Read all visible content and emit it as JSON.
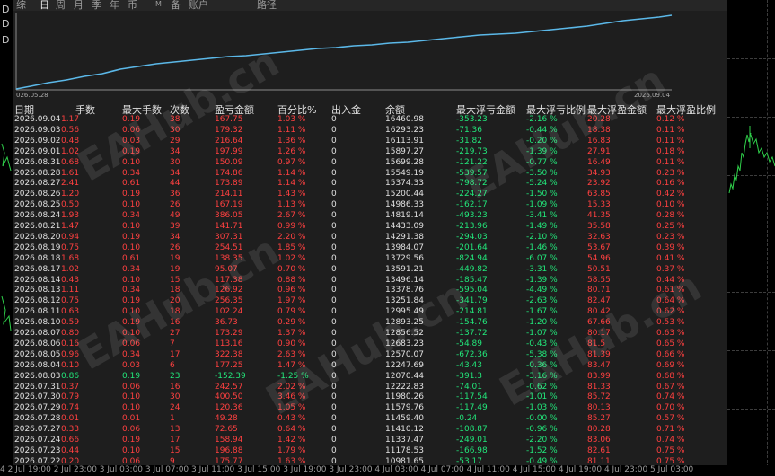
{
  "tabs": [
    "综",
    "日",
    "周",
    "月",
    "季",
    "年",
    "币",
    "M",
    "备",
    "账户",
    "路径"
  ],
  "active_tab": "日",
  "curve": {
    "start_label": "026.05.28",
    "end_label": "2026.09.04",
    "line_color": "#5bb8e8"
  },
  "headers": {
    "date": "日期",
    "lots": "手数",
    "max_lots": "最大手数",
    "count": "次数",
    "pnl": "盈亏金额",
    "pct": "百分比%",
    "io": "出入金",
    "balance": "余额",
    "max_float_loss": "最大浮亏金额",
    "max_float_loss_pct": "最大浮亏比例",
    "max_float_profit": "最大浮盈金额",
    "max_float_profit_pct": "最大浮盈比例"
  },
  "rows": [
    {
      "date": "2026.09.04",
      "lots": "1.17",
      "max_lots": "0.19",
      "count": "38",
      "pnl": "167.75",
      "pct": "1.03 %",
      "io": "0",
      "balance": "16460.98",
      "fl": "-353.23",
      "flp": "-2.16 %",
      "fp": "20.28",
      "fpp": "0.12 %"
    },
    {
      "date": "2026.09.03",
      "lots": "0.56",
      "max_lots": "0.06",
      "count": "30",
      "pnl": "179.32",
      "pct": "1.11 %",
      "io": "0",
      "balance": "16293.23",
      "fl": "-71.36",
      "flp": "-0.44 %",
      "fp": "18.38",
      "fpp": "0.11 %"
    },
    {
      "date": "2026.09.02",
      "lots": "0.48",
      "max_lots": "0.03",
      "count": "29",
      "pnl": "216.64",
      "pct": "1.36 %",
      "io": "0",
      "balance": "16113.91",
      "fl": "-31.82",
      "flp": "-0.20 %",
      "fp": "16.83",
      "fpp": "0.11 %"
    },
    {
      "date": "2026.09.01",
      "lots": "1.02",
      "max_lots": "0.19",
      "count": "34",
      "pnl": "197.99",
      "pct": "1.26 %",
      "io": "0",
      "balance": "15897.27",
      "fl": "-219.73",
      "flp": "-1.39 %",
      "fp": "27.91",
      "fpp": "0.18 %"
    },
    {
      "date": "2026.08.31",
      "lots": "0.68",
      "max_lots": "0.10",
      "count": "30",
      "pnl": "150.09",
      "pct": "0.97 %",
      "io": "0",
      "balance": "15699.28",
      "fl": "-121.22",
      "flp": "-0.77 %",
      "fp": "16.49",
      "fpp": "0.11 %"
    },
    {
      "date": "2026.08.28",
      "lots": "1.61",
      "max_lots": "0.34",
      "count": "34",
      "pnl": "174.86",
      "pct": "1.14 %",
      "io": "0",
      "balance": "15549.19",
      "fl": "-539.57",
      "flp": "-3.50 %",
      "fp": "34.93",
      "fpp": "0.23 %"
    },
    {
      "date": "2026.08.27",
      "lots": "2.41",
      "max_lots": "0.61",
      "count": "44",
      "pnl": "173.89",
      "pct": "1.14 %",
      "io": "0",
      "balance": "15374.33",
      "fl": "-798.72",
      "flp": "-5.24 %",
      "fp": "23.92",
      "fpp": "0.16 %"
    },
    {
      "date": "2026.08.26",
      "lots": "1.20",
      "max_lots": "0.19",
      "count": "36",
      "pnl": "214.11",
      "pct": "1.43 %",
      "io": "0",
      "balance": "15200.44",
      "fl": "-224.27",
      "flp": "-1.50 %",
      "fp": "63.85",
      "fpp": "0.42 %"
    },
    {
      "date": "2026.08.25",
      "lots": "0.50",
      "max_lots": "0.10",
      "count": "26",
      "pnl": "167.19",
      "pct": "1.13 %",
      "io": "0",
      "balance": "14986.33",
      "fl": "-162.17",
      "flp": "-1.09 %",
      "fp": "15.33",
      "fpp": "0.10 %"
    },
    {
      "date": "2026.08.24",
      "lots": "1.93",
      "max_lots": "0.34",
      "count": "49",
      "pnl": "386.05",
      "pct": "2.67 %",
      "io": "0",
      "balance": "14819.14",
      "fl": "-493.23",
      "flp": "-3.41 %",
      "fp": "41.35",
      "fpp": "0.28 %"
    },
    {
      "date": "2026.08.21",
      "lots": "1.47",
      "max_lots": "0.10",
      "count": "39",
      "pnl": "141.71",
      "pct": "0.99 %",
      "io": "0",
      "balance": "14433.09",
      "fl": "-213.96",
      "flp": "-1.49 %",
      "fp": "35.58",
      "fpp": "0.25 %"
    },
    {
      "date": "2026.08.20",
      "lots": "0.94",
      "max_lots": "0.19",
      "count": "34",
      "pnl": "307.31",
      "pct": "2.20 %",
      "io": "0",
      "balance": "14291.38",
      "fl": "-294.03",
      "flp": "-2.10 %",
      "fp": "32.63",
      "fpp": "0.23 %"
    },
    {
      "date": "2026.08.19",
      "lots": "0.75",
      "max_lots": "0.10",
      "count": "26",
      "pnl": "254.51",
      "pct": "1.85 %",
      "io": "0",
      "balance": "13984.07",
      "fl": "-201.64",
      "flp": "-1.46 %",
      "fp": "53.67",
      "fpp": "0.39 %"
    },
    {
      "date": "2026.08.18",
      "lots": "1.68",
      "max_lots": "0.61",
      "count": "19",
      "pnl": "138.35",
      "pct": "1.02 %",
      "io": "0",
      "balance": "13729.56",
      "fl": "-824.94",
      "flp": "-6.07 %",
      "fp": "54.96",
      "fpp": "0.41 %"
    },
    {
      "date": "2026.08.17",
      "lots": "1.02",
      "max_lots": "0.34",
      "count": "19",
      "pnl": "95.07",
      "pct": "0.70 %",
      "io": "0",
      "balance": "13591.21",
      "fl": "-449.82",
      "flp": "-3.31 %",
      "fp": "50.51",
      "fpp": "0.37 %"
    },
    {
      "date": "2026.08.14",
      "lots": "0.43",
      "max_lots": "0.10",
      "count": "15",
      "pnl": "117.38",
      "pct": "0.88 %",
      "io": "0",
      "balance": "13496.14",
      "fl": "-185.47",
      "flp": "-1.39 %",
      "fp": "58.55",
      "fpp": "0.44 %"
    },
    {
      "date": "2026.08.13",
      "lots": "1.11",
      "max_lots": "0.34",
      "count": "18",
      "pnl": "126.92",
      "pct": "0.96 %",
      "io": "0",
      "balance": "13378.76",
      "fl": "-595.04",
      "flp": "-4.49 %",
      "fp": "80.71",
      "fpp": "0.61 %"
    },
    {
      "date": "2026.08.12",
      "lots": "0.75",
      "max_lots": "0.19",
      "count": "20",
      "pnl": "256.35",
      "pct": "1.97 %",
      "io": "0",
      "balance": "13251.84",
      "fl": "-341.79",
      "flp": "-2.63 %",
      "fp": "82.47",
      "fpp": "0.64 %"
    },
    {
      "date": "2026.08.11",
      "lots": "0.63",
      "max_lots": "0.10",
      "count": "18",
      "pnl": "102.24",
      "pct": "0.79 %",
      "io": "0",
      "balance": "12995.49",
      "fl": "-214.81",
      "flp": "-1.67 %",
      "fp": "80.42",
      "fpp": "0.62 %"
    },
    {
      "date": "2026.08.10",
      "lots": "0.59",
      "max_lots": "0.19",
      "count": "16",
      "pnl": "36.73",
      "pct": "0.29 %",
      "io": "0",
      "balance": "12893.25",
      "fl": "-154.76",
      "flp": "-1.20 %",
      "fp": "67.66",
      "fpp": "0.53 %"
    },
    {
      "date": "2026.08.07",
      "lots": "0.80",
      "max_lots": "0.10",
      "count": "27",
      "pnl": "173.29",
      "pct": "1.37 %",
      "io": "0",
      "balance": "12856.52",
      "fl": "-137.72",
      "flp": "-1.07 %",
      "fp": "80.17",
      "fpp": "0.63 %"
    },
    {
      "date": "2026.08.06",
      "lots": "0.16",
      "max_lots": "0.06",
      "count": "7",
      "pnl": "113.16",
      "pct": "0.90 %",
      "io": "0",
      "balance": "12683.23",
      "fl": "-54.89",
      "flp": "-0.43 %",
      "fp": "81.5",
      "fpp": "0.65 %"
    },
    {
      "date": "2026.08.05",
      "lots": "0.96",
      "max_lots": "0.34",
      "count": "17",
      "pnl": "322.38",
      "pct": "2.63 %",
      "io": "0",
      "balance": "12570.07",
      "fl": "-672.36",
      "flp": "-5.38 %",
      "fp": "81.39",
      "fpp": "0.66 %"
    },
    {
      "date": "2026.08.04",
      "lots": "0.10",
      "max_lots": "0.03",
      "count": "6",
      "pnl": "177.25",
      "pct": "1.47 %",
      "io": "0",
      "balance": "12247.69",
      "fl": "-43.43",
      "flp": "-0.36 %",
      "fp": "83.47",
      "fpp": "0.69 %"
    },
    {
      "date": "2026.08.03",
      "lots": "0.86",
      "max_lots": "0.19",
      "count": "23",
      "pnl": "-152.39",
      "pct": "-1.25 %",
      "io": "0",
      "balance": "12070.44",
      "fl": "-391.3",
      "flp": "-3.16 %",
      "fp": "83.99",
      "fpp": "0.68 %",
      "negative": true
    },
    {
      "date": "2026.07.31",
      "lots": "0.37",
      "max_lots": "0.06",
      "count": "16",
      "pnl": "242.57",
      "pct": "2.02 %",
      "io": "0",
      "balance": "12222.83",
      "fl": "-74.01",
      "flp": "-0.62 %",
      "fp": "81.33",
      "fpp": "0.67 %"
    },
    {
      "date": "2026.07.30",
      "lots": "0.79",
      "max_lots": "0.10",
      "count": "30",
      "pnl": "400.50",
      "pct": "3.46 %",
      "io": "0",
      "balance": "11980.26",
      "fl": "-117.54",
      "flp": "-1.01 %",
      "fp": "85.72",
      "fpp": "0.74 %"
    },
    {
      "date": "2026.07.29",
      "lots": "0.74",
      "max_lots": "0.10",
      "count": "24",
      "pnl": "120.36",
      "pct": "1.05 %",
      "io": "0",
      "balance": "11579.76",
      "fl": "-117.49",
      "flp": "-1.03 %",
      "fp": "80.13",
      "fpp": "0.70 %"
    },
    {
      "date": "2026.07.28",
      "lots": "0.01",
      "max_lots": "0.01",
      "count": "1",
      "pnl": "49.28",
      "pct": "0.43 %",
      "io": "0",
      "balance": "11459.40",
      "fl": "-0.24",
      "flp": "-0.00 %",
      "fp": "85.27",
      "fpp": "0.57 %"
    },
    {
      "date": "2026.07.27",
      "lots": "0.33",
      "max_lots": "0.06",
      "count": "13",
      "pnl": "72.65",
      "pct": "0.64 %",
      "io": "0",
      "balance": "11410.12",
      "fl": "-108.87",
      "flp": "-0.96 %",
      "fp": "80.28",
      "fpp": "0.71 %"
    },
    {
      "date": "2026.07.24",
      "lots": "0.66",
      "max_lots": "0.19",
      "count": "17",
      "pnl": "158.94",
      "pct": "1.42 %",
      "io": "0",
      "balance": "11337.47",
      "fl": "-249.01",
      "flp": "-2.20 %",
      "fp": "83.06",
      "fpp": "0.74 %"
    },
    {
      "date": "2026.07.23",
      "lots": "0.44",
      "max_lots": "0.10",
      "count": "15",
      "pnl": "196.88",
      "pct": "1.79 %",
      "io": "0",
      "balance": "11178.53",
      "fl": "-166.98",
      "flp": "-1.52 %",
      "fp": "82.61",
      "fpp": "0.75 %"
    },
    {
      "date": "2026.07.22",
      "lots": "0.20",
      "max_lots": "0.06",
      "count": "9",
      "pnl": "175.77",
      "pct": "1.63 %",
      "io": "0",
      "balance": "10981.65",
      "fl": "-53.17",
      "flp": "-0.49 %",
      "fp": "81.11",
      "fpp": "0.75 %"
    }
  ],
  "watermark": "EAHub.cn",
  "left_glyphs": [
    "D",
    "D",
    "D"
  ],
  "bottom_axis": "4 2 Jul 19:00  2 Jul 23:00  3 Jul 03:00  3 Jul 07:00  3 Jul 11:00  3 Jul 15:00  3 Jul 19:00  3 Jul 23:00  4 Jul 03:00  4 Jul 07:00  4 Jul 11:00  4 Jul 15:00  4 Jul 19:00  4 Jul 23:00  5 Jul 03:00",
  "colors": {
    "loss": "#ff4040",
    "gain": "#22e67a",
    "text": "#e0e0e0",
    "panel": "#1e1e1e"
  }
}
